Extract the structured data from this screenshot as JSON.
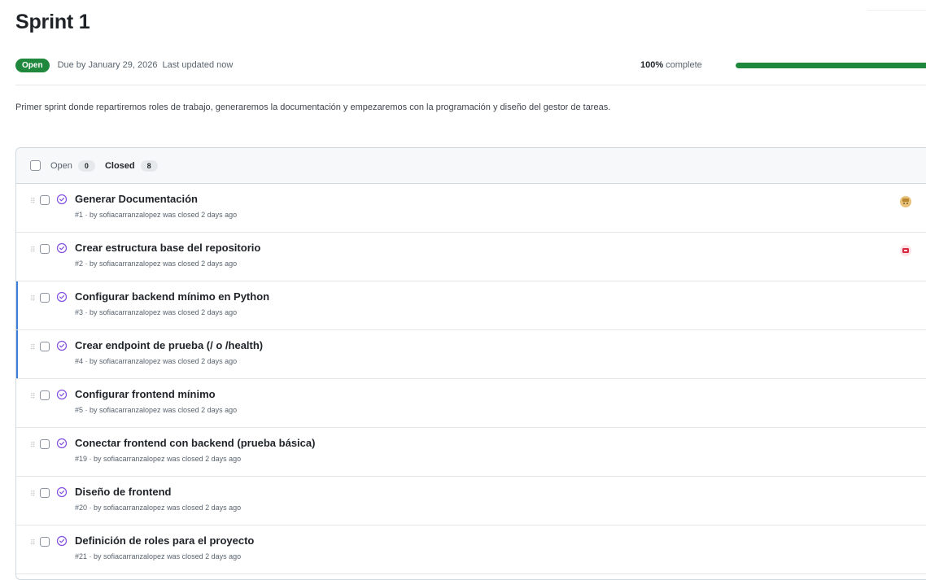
{
  "milestone": {
    "title": "Sprint 1",
    "status": "Open",
    "due": "Due by January 29, 2026",
    "updated": "Last updated now",
    "progress_label": "100%",
    "progress_suffix": "complete",
    "progress_fraction": 1.0,
    "description": "Primer sprint donde repartiremos roles de trabajo, generaremos la documentación y empezaremos con la programación y diseño del gestor de tareas."
  },
  "tabs": [
    {
      "label": "Open",
      "count": "0"
    },
    {
      "label": "Closed",
      "count": "8"
    }
  ],
  "colors": {
    "accent": "#1f883d",
    "closed_icon": "#8250df",
    "selection": "#3b7dd8"
  },
  "issues": [
    {
      "title": "Generar Documentación",
      "meta": "#1 · by sofiacarranzalopez was closed 2 days ago",
      "avatar": "assignee-avatar-yellow"
    },
    {
      "title": "Crear estructura base del repositorio",
      "meta": "#2 · by sofiacarranzalopez was closed 2 days ago",
      "avatar": "assignee-avatar-red"
    },
    {
      "title": "Configurar backend mínimo en Python",
      "meta": "#3 · by sofiacarranzalopez was closed 2 days ago"
    },
    {
      "title": "Crear endpoint de prueba (/ o /health)",
      "meta": "#4 · by sofiacarranzalopez was closed 2 days ago"
    },
    {
      "title": "Configurar frontend mínimo",
      "meta": "#5 · by sofiacarranzalopez was closed 2 days ago"
    },
    {
      "title": "Conectar frontend con backend (prueba básica)",
      "meta": "#19 · by sofiacarranzalopez was closed 2 days ago"
    },
    {
      "title": "Diseño de frontend",
      "meta": "#20 · by sofiacarranzalopez was closed 2 days ago"
    },
    {
      "title": "Definición de roles para el proyecto",
      "meta": "#21 · by sofiacarranzalopez was closed 2 days ago"
    }
  ]
}
